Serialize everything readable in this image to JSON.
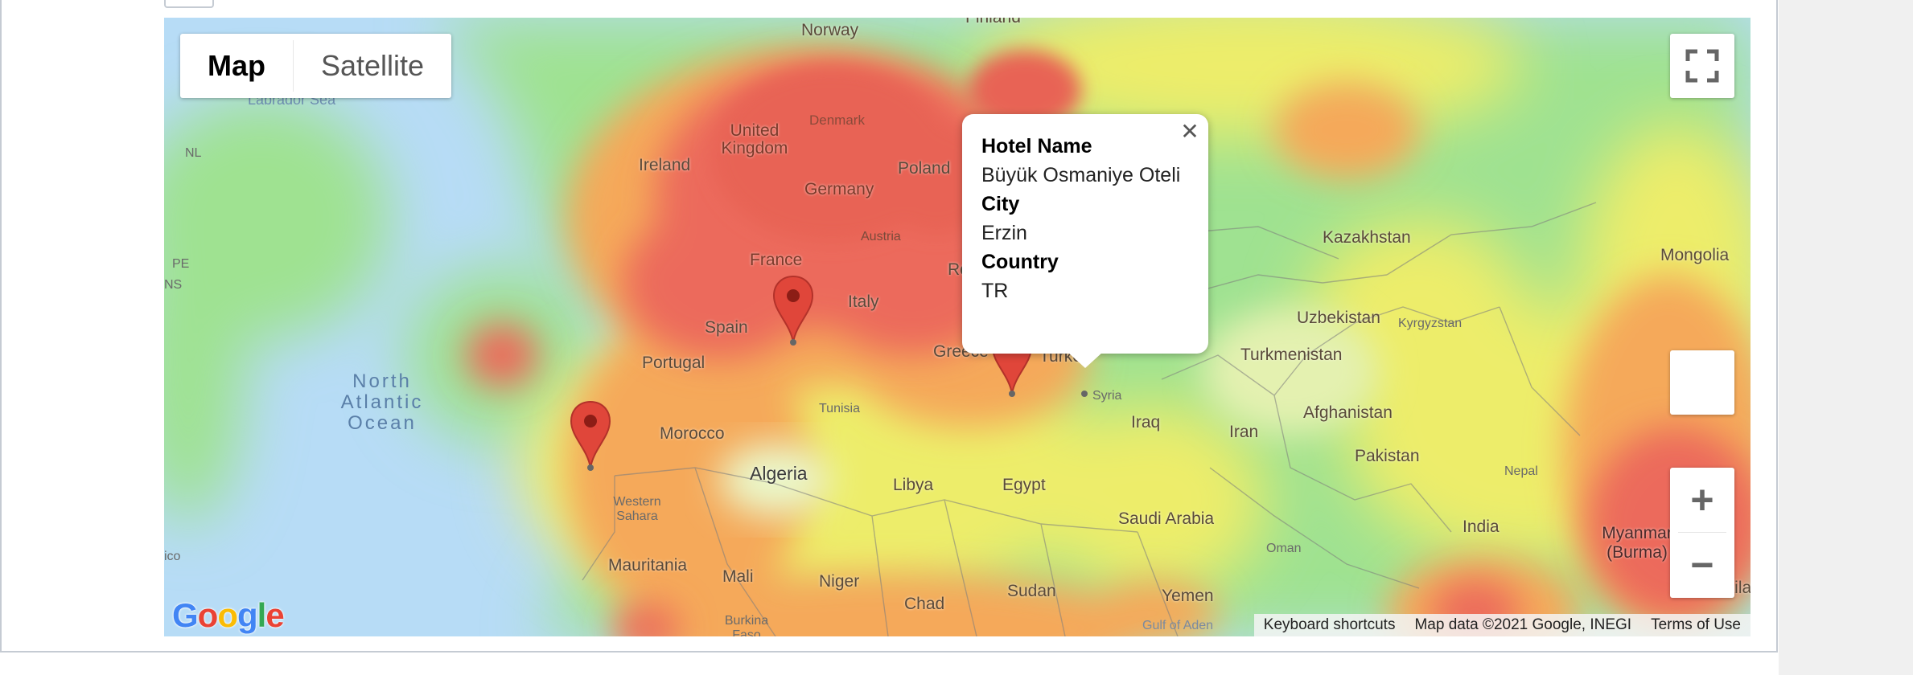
{
  "map": {
    "type_control": {
      "options": [
        "Map",
        "Satellite"
      ],
      "selected": "Map"
    },
    "zoom": {
      "in_symbol": "+",
      "out_symbol": "−"
    },
    "icons": {
      "fullscreen": "fullscreen-icon",
      "close": "close-icon",
      "marker": "map-marker-icon",
      "pegman": "pegman-icon"
    },
    "heat_colors": [
      "#b7dcf6",
      "#a5e39d",
      "#f3ef6a",
      "#f7b55a",
      "#ec6b5c"
    ],
    "marker_color": "#e0463a",
    "labels": {
      "countries": [
        "Norway",
        "Finland",
        "Denmark",
        "United Kingdom",
        "Ireland",
        "Germany",
        "Poland",
        "Austria",
        "France",
        "Italy",
        "Spain",
        "Portugal",
        "Morocco",
        "Tunisia",
        "Algeria",
        "Libya",
        "Egypt",
        "Western Sahara",
        "Mauritania",
        "Mali",
        "Niger",
        "Chad",
        "Sudan",
        "Burkina Faso",
        "Kazakhstan",
        "Mongolia",
        "Uzbekistan",
        "Kyrgyzstan",
        "Turkmenistan",
        "Afghanistan",
        "Iran",
        "Iraq",
        "Syria",
        "Pakistan",
        "Nepal",
        "India",
        "Myanmar (Burma)",
        "Saudi Arabia",
        "Oman",
        "Yemen",
        "Greece",
        "Romania",
        "Turkey",
        "Thailand"
      ],
      "water": [
        "Labrador Sea",
        "North Atlantic Ocean",
        "Gulf of Aden"
      ],
      "edge": [
        "NL",
        "PE",
        "NS",
        "ico"
      ]
    },
    "info_window": {
      "fields": [
        {
          "key": "Hotel Name",
          "value": "Büyük Osmaniye Oteli"
        },
        {
          "key": "City",
          "value": "Erzin"
        },
        {
          "key": "Country",
          "value": "TR"
        }
      ]
    },
    "branding": "Google",
    "attribution": [
      "Keyboard shortcuts",
      "Map data ©2021 Google, INEGI",
      "Terms of Use"
    ]
  }
}
